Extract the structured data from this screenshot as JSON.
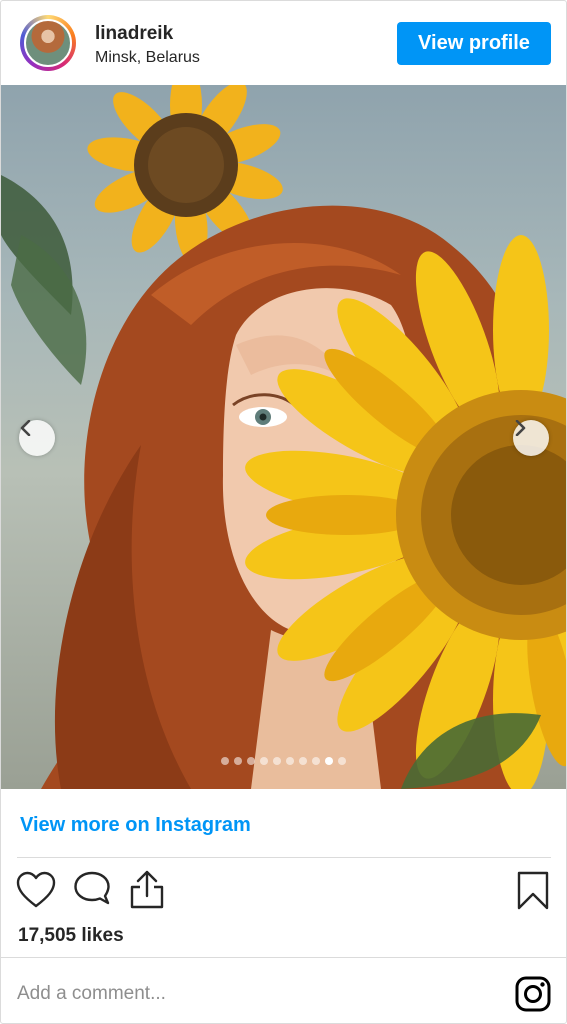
{
  "post": {
    "username": "linadreik",
    "location": "Minsk, Belarus",
    "view_profile_label": "View profile",
    "view_more_label": "View more on Instagram",
    "likes_text": "17,505 likes",
    "comment_placeholder": "Add a comment..."
  },
  "carousel": {
    "dot_count": 10,
    "active_index": 8
  },
  "icons": {
    "avatar": "profile-avatar",
    "like": "heart-icon",
    "comment": "comment-bubble-icon",
    "share": "share-icon",
    "save": "bookmark-icon",
    "brand": "instagram-icon",
    "prev": "chevron-left-icon",
    "next": "chevron-right-icon"
  },
  "colors": {
    "accent": "#0095f6",
    "text": "#262626",
    "muted": "#8e8e8e",
    "border": "#dbdbdb"
  }
}
